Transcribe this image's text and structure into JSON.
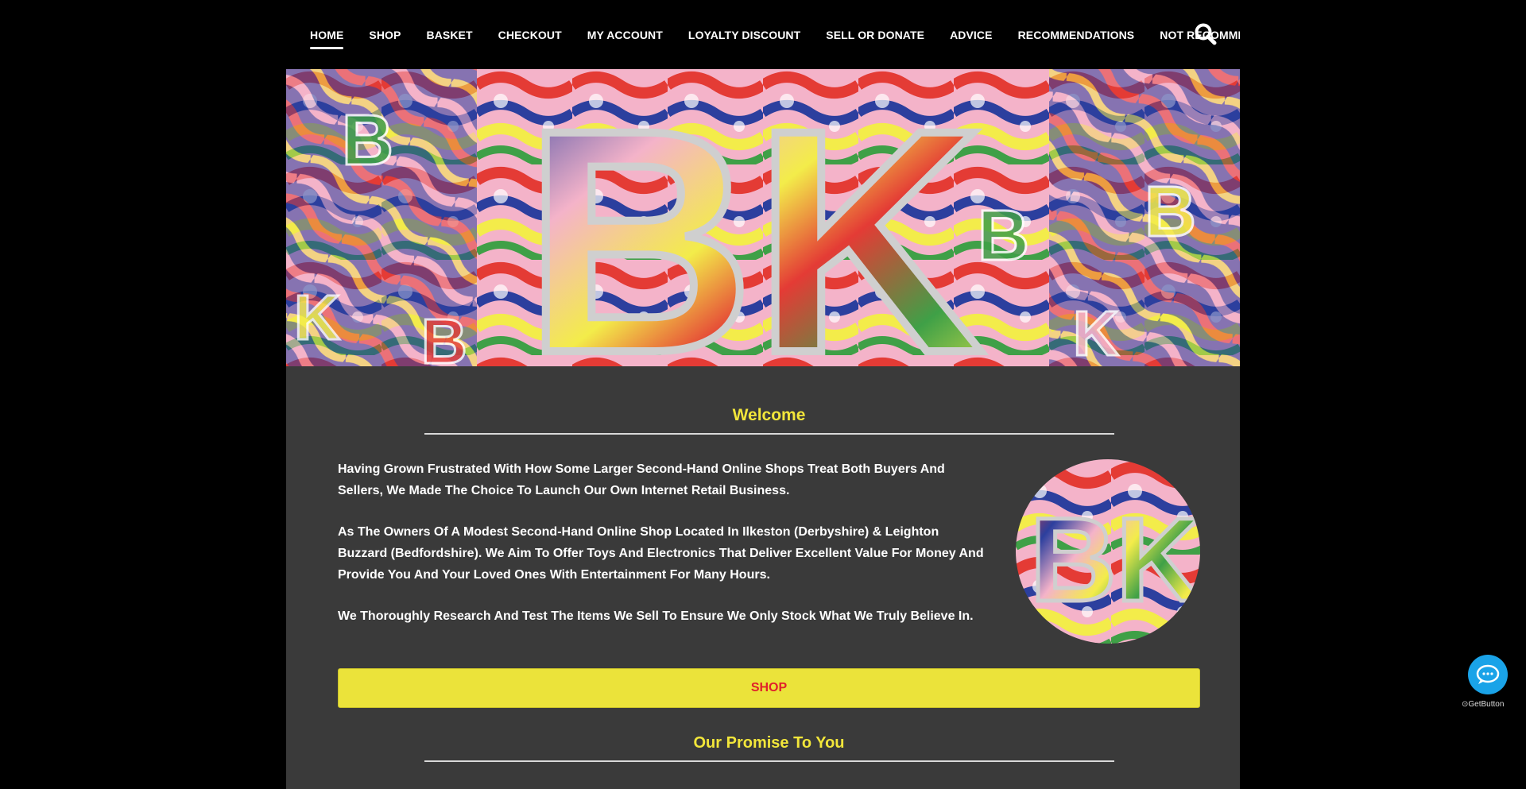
{
  "nav": {
    "items": [
      {
        "label": "HOME",
        "active": true
      },
      {
        "label": "SHOP"
      },
      {
        "label": "BASKET"
      },
      {
        "label": "CHECKOUT"
      },
      {
        "label": "MY ACCOUNT"
      },
      {
        "label": "LOYALTY DISCOUNT"
      },
      {
        "label": "SELL OR DONATE"
      },
      {
        "label": "ADVICE"
      },
      {
        "label": "RECOMMENDATIONS"
      },
      {
        "label": "NOT RECOMMENDED"
      }
    ],
    "search_icon": "search-icon"
  },
  "hero": {
    "logo_text": "BK",
    "colors": [
      "#f4b3c9",
      "#2c3f9e",
      "#e43b35",
      "#3fa047",
      "#f3ec4a"
    ]
  },
  "welcome": {
    "title": "Welcome",
    "paragraphs": [
      "Having Grown Frustrated With How Some Larger Second-Hand Online Shops Treat Both Buyers And Sellers, We Made The Choice To Launch Our Own Internet Retail Business.",
      "As The Owners Of A Modest Second-Hand Online Shop Located In Ilkeston (Derbyshire) & Leighton Buzzard (Bedfordshire). We Aim To Offer Toys And Electronics That Deliver Excellent Value For Money And Provide You And Your Loved Ones With Entertainment For Many Hours.",
      "We Thoroughly Research And Test The Items We Sell To Ensure We Only Stock What We Truly Believe In."
    ],
    "logo_text": "BK"
  },
  "shop_button": {
    "label": "SHOP"
  },
  "promise": {
    "title": "Our Promise To You"
  },
  "chat": {
    "icon": "chat-bubble-icon",
    "label": "GetButton"
  },
  "colors": {
    "accent_yellow": "#f2e63a",
    "button_yellow": "#ebe33a",
    "button_text_red": "#e0202a",
    "background_dark": "#3a3a3a",
    "chat_blue": "#1aa3e8"
  }
}
